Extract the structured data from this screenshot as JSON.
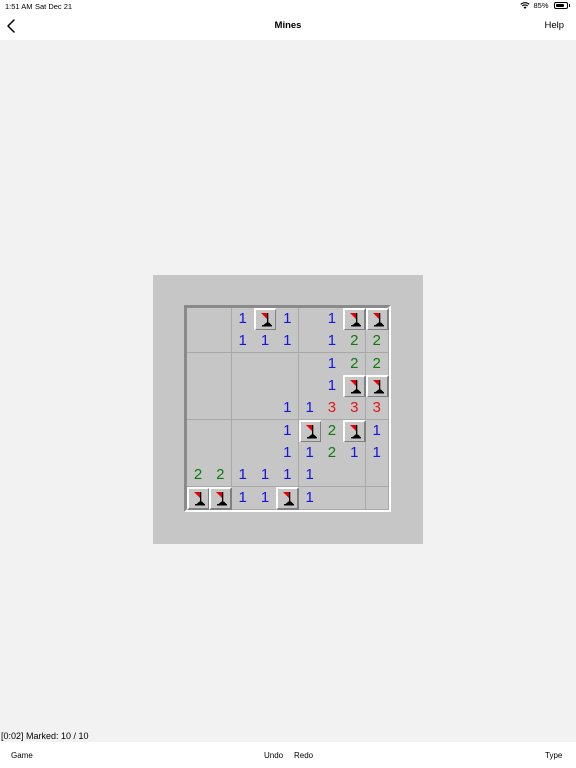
{
  "status_bar": {
    "time": "1:51 AM",
    "date": "Sat Dec 21",
    "battery": "85%",
    "battery_level": 0.85
  },
  "nav": {
    "title": "Mines",
    "help": "Help"
  },
  "board": {
    "rows": [
      [
        "O",
        "O",
        "1",
        "F",
        "1",
        "O",
        "1",
        "F",
        "F"
      ],
      [
        "O",
        "O",
        "1",
        "1",
        "1",
        "O",
        "1",
        "2",
        "2"
      ],
      [
        "O",
        "O",
        "O",
        "O",
        "O",
        "O",
        "1",
        "2",
        "2"
      ],
      [
        "O",
        "O",
        "O",
        "O",
        "O",
        "O",
        "1",
        "F",
        "F"
      ],
      [
        "O",
        "O",
        "O",
        "O",
        "1",
        "1",
        "3",
        "3",
        "3"
      ],
      [
        "O",
        "O",
        "O",
        "O",
        "1",
        "F",
        "2",
        "F",
        "1"
      ],
      [
        "O",
        "O",
        "O",
        "O",
        "1",
        "1",
        "2",
        "1",
        "1"
      ],
      [
        "2",
        "2",
        "1",
        "1",
        "1",
        "1",
        "O",
        "O",
        "O"
      ],
      [
        "F",
        "F",
        "1",
        "1",
        "F",
        "1",
        "O",
        "O",
        "O"
      ]
    ],
    "number_colors": {
      "1": "#1414e6",
      "2": "#0e7a0e",
      "3": "#e61414"
    },
    "flag_color": "#e60000"
  },
  "status": "[0:02] Marked: 10 / 10",
  "toolbar": {
    "game": "Game",
    "undo": "Undo",
    "redo": "Redo",
    "type": "Type"
  }
}
